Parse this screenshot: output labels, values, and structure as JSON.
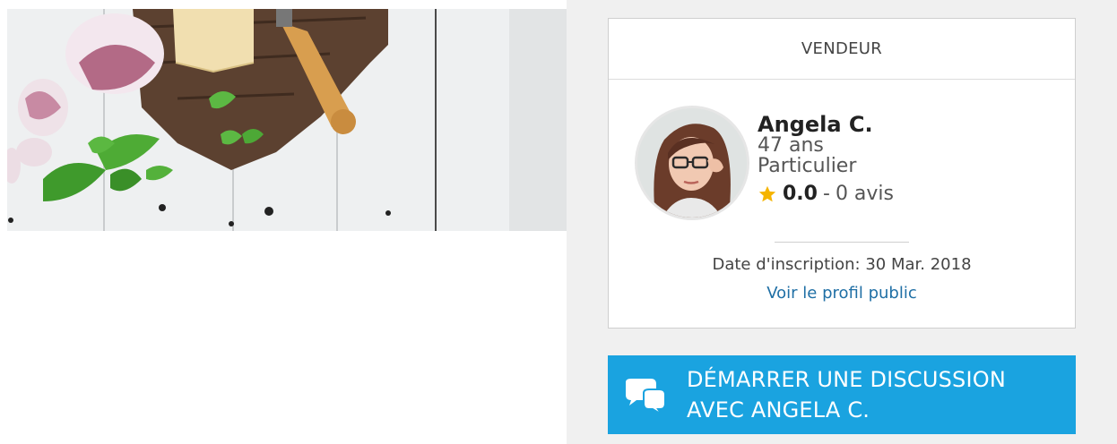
{
  "seller": {
    "section_title": "VENDEUR",
    "name": "Angela C.",
    "age": "47 ans",
    "type": "Particulier",
    "rating_score": "0.0",
    "rating_separator": "-",
    "rating_reviews": "0 avis",
    "signup_date": "Date d'inscription: 30 Mar. 2018",
    "public_profile_link": "Voir le profil public"
  },
  "chat": {
    "label_line1": "DÉMARRER UNE DISCUSSION",
    "label_line2": "AVEC ANGELA C."
  },
  "colors": {
    "accent": "#1aa3e0",
    "link": "#1f6fa5",
    "star": "#f5b400",
    "panel_bg": "#f0f0f0"
  },
  "icons": [
    "star-icon",
    "chat-bubbles-icon"
  ]
}
